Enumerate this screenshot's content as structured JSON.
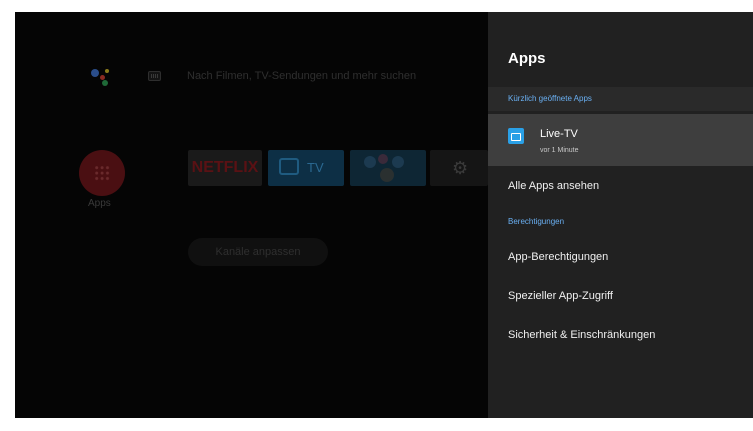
{
  "home": {
    "search_placeholder": "Nach Filmen, TV-Sendungen und mehr suchen",
    "apps_label": "Apps",
    "tiles": {
      "netflix": "NETFLIX",
      "tv": "TV"
    },
    "channels_button": "Kanäle anpassen"
  },
  "panel": {
    "title": "Apps",
    "recent_header": "Kürzlich geöffnete Apps",
    "recent_apps": [
      {
        "name": "Live-TV",
        "time": "vor 1 Minute"
      }
    ],
    "all_apps": "Alle Apps ansehen",
    "permissions_header": "Berechtigungen",
    "items": [
      "App-Berechtigungen",
      "Spezieller App-Zugriff",
      "Sicherheit & Einschränkungen"
    ]
  },
  "colors": {
    "accent": "#6ab0f3",
    "panel_bg": "#212121",
    "focus_bg": "#3e3e3e"
  }
}
